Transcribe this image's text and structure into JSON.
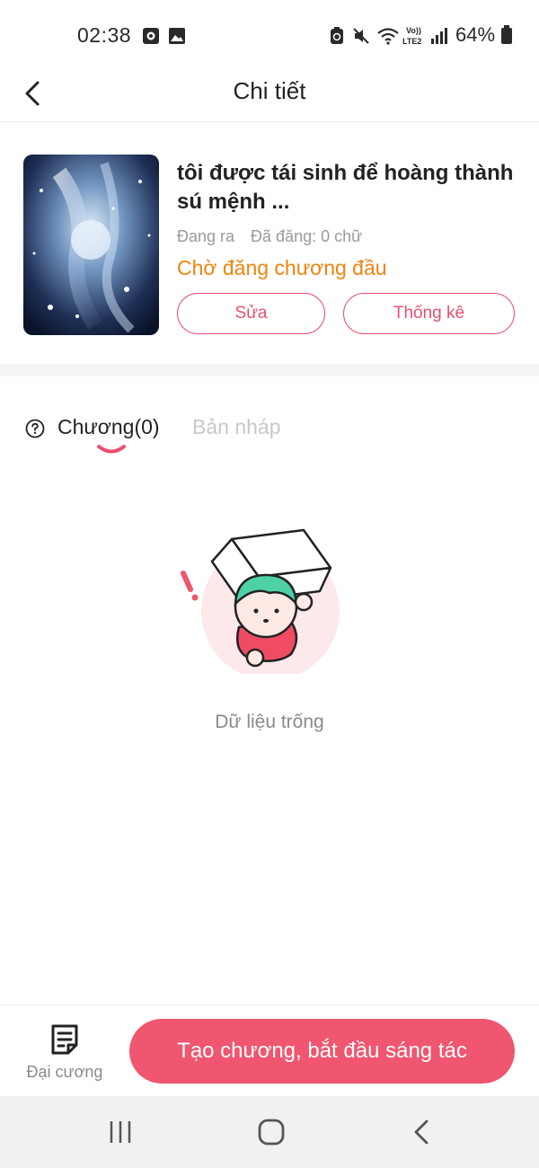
{
  "status_bar": {
    "time": "02:38",
    "battery": "64%",
    "icons": [
      "alarm-icon",
      "gallery-icon",
      "battery-saver-icon",
      "mute-icon",
      "wifi-icon",
      "volte-icon",
      "signal-icon",
      "battery-icon"
    ]
  },
  "header": {
    "title": "Chi tiết",
    "back_icon": "chevron-left-icon"
  },
  "book": {
    "title": "tôi được tái sinh để hoàng thành sú mệnh ...",
    "status_label": "Đang ra",
    "words_label": "Đã đăng: 0 chữ",
    "publish_status": "Chờ đăng chương đầu",
    "edit_label": "Sửa",
    "stats_label": "Thống kê",
    "accent_color": "#e9506e",
    "status_color": "#f0820f"
  },
  "tabs": {
    "chapters_label": "Chương(0)",
    "drafts_label": "Bản nháp",
    "help_icon": "question-circle-icon"
  },
  "empty_state": {
    "text": "Dữ liệu trống",
    "illustration": "box-character-illustration"
  },
  "bottom_bar": {
    "outline_label": "Đại cương",
    "outline_icon": "document-list-icon",
    "create_label": "Tạo chương, bắt đầu sáng tác",
    "create_color": "#f0566f"
  },
  "system_nav": {
    "items": [
      "recent-apps-icon",
      "home-icon",
      "back-icon"
    ]
  }
}
